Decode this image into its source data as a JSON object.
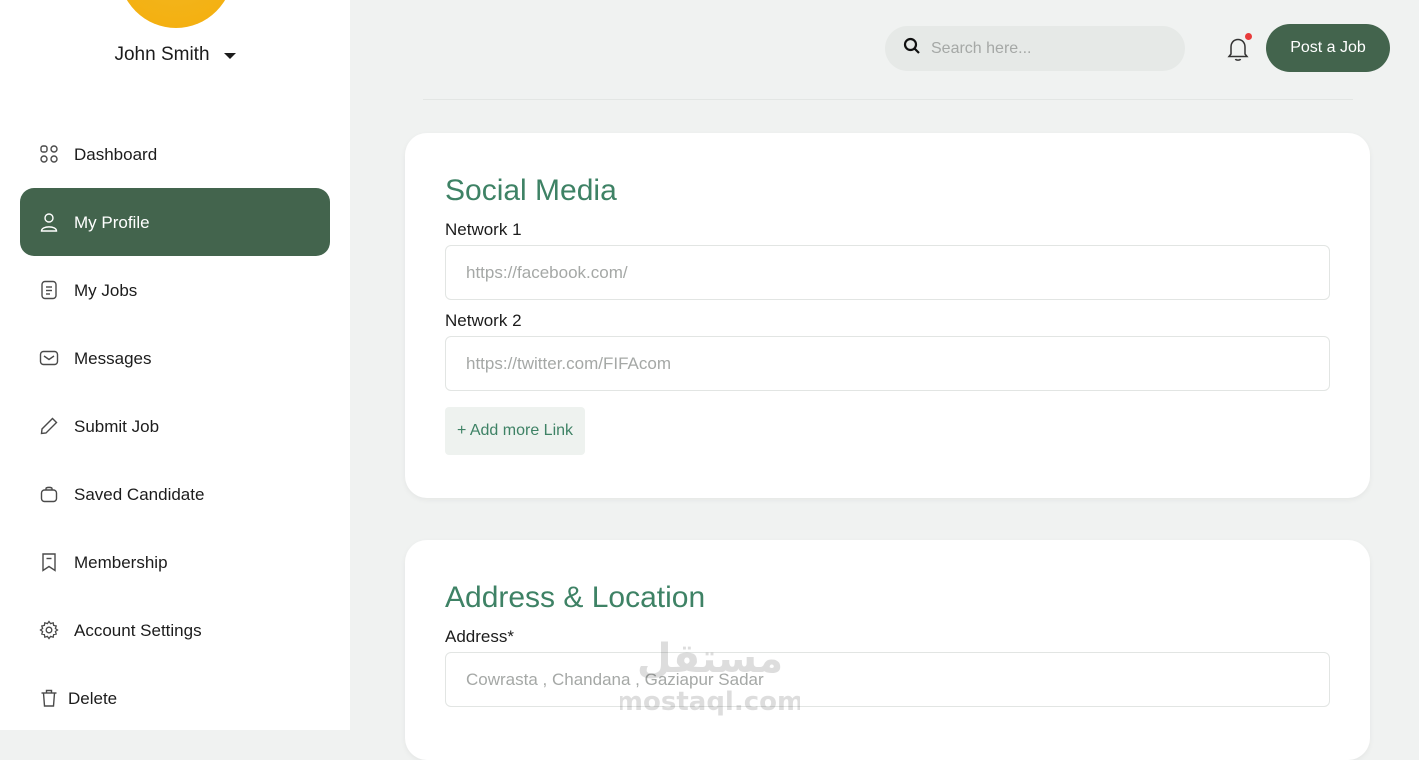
{
  "user": {
    "name": "John Smith"
  },
  "sidebar": {
    "items": [
      {
        "label": "Dashboard",
        "icon": "grid-icon"
      },
      {
        "label": "My Profile",
        "icon": "user-icon",
        "active": true
      },
      {
        "label": "My Jobs",
        "icon": "document-icon"
      },
      {
        "label": "Messages",
        "icon": "envelope-icon"
      },
      {
        "label": "Submit Job",
        "icon": "pencil-icon"
      },
      {
        "label": "Saved Candidate",
        "icon": "briefcase-icon"
      },
      {
        "label": "Membership",
        "icon": "bookmark-icon"
      },
      {
        "label": "Account Settings",
        "icon": "gear-icon"
      },
      {
        "label": "Delete",
        "icon": "trash-icon"
      }
    ]
  },
  "topbar": {
    "search_placeholder": "Search here...",
    "post_button": "Post a Job"
  },
  "social": {
    "title": "Social Media",
    "network1_label": "Network 1",
    "network1_value": "https://facebook.com/",
    "network2_label": "Network 2",
    "network2_value": "https://twitter.com/FIFAcom",
    "add_link_label": "+ Add more Link"
  },
  "address": {
    "title": "Address & Location",
    "address_label": "Address*",
    "address_value": "Cowrasta , Chandana , Gaziapur Sadar"
  },
  "watermark": {
    "text_latin": "mostaql.com",
    "text_arabic": "مستقل"
  },
  "colors": {
    "accent": "#43644d",
    "heading": "#3e8265",
    "background": "#f0f2f1",
    "notification_dot": "#e83b3b"
  }
}
